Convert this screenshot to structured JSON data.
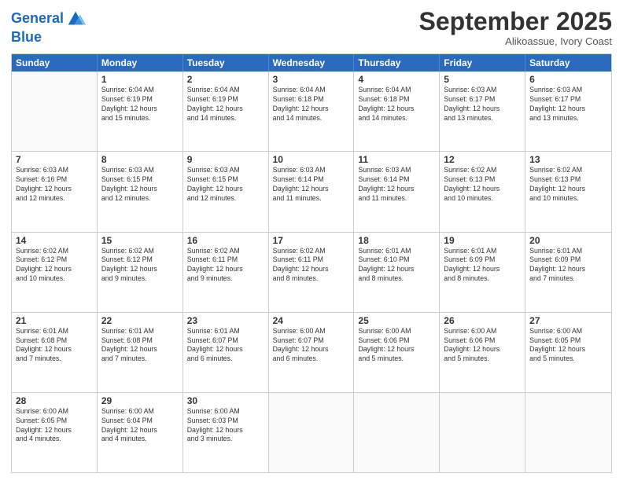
{
  "header": {
    "logo_line1": "General",
    "logo_line2": "Blue",
    "month": "September 2025",
    "location": "Alikoassue, Ivory Coast"
  },
  "weekdays": [
    "Sunday",
    "Monday",
    "Tuesday",
    "Wednesday",
    "Thursday",
    "Friday",
    "Saturday"
  ],
  "rows": [
    [
      {
        "day": "",
        "info": ""
      },
      {
        "day": "1",
        "info": "Sunrise: 6:04 AM\nSunset: 6:19 PM\nDaylight: 12 hours\nand 15 minutes."
      },
      {
        "day": "2",
        "info": "Sunrise: 6:04 AM\nSunset: 6:19 PM\nDaylight: 12 hours\nand 14 minutes."
      },
      {
        "day": "3",
        "info": "Sunrise: 6:04 AM\nSunset: 6:18 PM\nDaylight: 12 hours\nand 14 minutes."
      },
      {
        "day": "4",
        "info": "Sunrise: 6:04 AM\nSunset: 6:18 PM\nDaylight: 12 hours\nand 14 minutes."
      },
      {
        "day": "5",
        "info": "Sunrise: 6:03 AM\nSunset: 6:17 PM\nDaylight: 12 hours\nand 13 minutes."
      },
      {
        "day": "6",
        "info": "Sunrise: 6:03 AM\nSunset: 6:17 PM\nDaylight: 12 hours\nand 13 minutes."
      }
    ],
    [
      {
        "day": "7",
        "info": "Sunrise: 6:03 AM\nSunset: 6:16 PM\nDaylight: 12 hours\nand 12 minutes."
      },
      {
        "day": "8",
        "info": "Sunrise: 6:03 AM\nSunset: 6:15 PM\nDaylight: 12 hours\nand 12 minutes."
      },
      {
        "day": "9",
        "info": "Sunrise: 6:03 AM\nSunset: 6:15 PM\nDaylight: 12 hours\nand 12 minutes."
      },
      {
        "day": "10",
        "info": "Sunrise: 6:03 AM\nSunset: 6:14 PM\nDaylight: 12 hours\nand 11 minutes."
      },
      {
        "day": "11",
        "info": "Sunrise: 6:03 AM\nSunset: 6:14 PM\nDaylight: 12 hours\nand 11 minutes."
      },
      {
        "day": "12",
        "info": "Sunrise: 6:02 AM\nSunset: 6:13 PM\nDaylight: 12 hours\nand 10 minutes."
      },
      {
        "day": "13",
        "info": "Sunrise: 6:02 AM\nSunset: 6:13 PM\nDaylight: 12 hours\nand 10 minutes."
      }
    ],
    [
      {
        "day": "14",
        "info": "Sunrise: 6:02 AM\nSunset: 6:12 PM\nDaylight: 12 hours\nand 10 minutes."
      },
      {
        "day": "15",
        "info": "Sunrise: 6:02 AM\nSunset: 6:12 PM\nDaylight: 12 hours\nand 9 minutes."
      },
      {
        "day": "16",
        "info": "Sunrise: 6:02 AM\nSunset: 6:11 PM\nDaylight: 12 hours\nand 9 minutes."
      },
      {
        "day": "17",
        "info": "Sunrise: 6:02 AM\nSunset: 6:11 PM\nDaylight: 12 hours\nand 8 minutes."
      },
      {
        "day": "18",
        "info": "Sunrise: 6:01 AM\nSunset: 6:10 PM\nDaylight: 12 hours\nand 8 minutes."
      },
      {
        "day": "19",
        "info": "Sunrise: 6:01 AM\nSunset: 6:09 PM\nDaylight: 12 hours\nand 8 minutes."
      },
      {
        "day": "20",
        "info": "Sunrise: 6:01 AM\nSunset: 6:09 PM\nDaylight: 12 hours\nand 7 minutes."
      }
    ],
    [
      {
        "day": "21",
        "info": "Sunrise: 6:01 AM\nSunset: 6:08 PM\nDaylight: 12 hours\nand 7 minutes."
      },
      {
        "day": "22",
        "info": "Sunrise: 6:01 AM\nSunset: 6:08 PM\nDaylight: 12 hours\nand 7 minutes."
      },
      {
        "day": "23",
        "info": "Sunrise: 6:01 AM\nSunset: 6:07 PM\nDaylight: 12 hours\nand 6 minutes."
      },
      {
        "day": "24",
        "info": "Sunrise: 6:00 AM\nSunset: 6:07 PM\nDaylight: 12 hours\nand 6 minutes."
      },
      {
        "day": "25",
        "info": "Sunrise: 6:00 AM\nSunset: 6:06 PM\nDaylight: 12 hours\nand 5 minutes."
      },
      {
        "day": "26",
        "info": "Sunrise: 6:00 AM\nSunset: 6:06 PM\nDaylight: 12 hours\nand 5 minutes."
      },
      {
        "day": "27",
        "info": "Sunrise: 6:00 AM\nSunset: 6:05 PM\nDaylight: 12 hours\nand 5 minutes."
      }
    ],
    [
      {
        "day": "28",
        "info": "Sunrise: 6:00 AM\nSunset: 6:05 PM\nDaylight: 12 hours\nand 4 minutes."
      },
      {
        "day": "29",
        "info": "Sunrise: 6:00 AM\nSunset: 6:04 PM\nDaylight: 12 hours\nand 4 minutes."
      },
      {
        "day": "30",
        "info": "Sunrise: 6:00 AM\nSunset: 6:03 PM\nDaylight: 12 hours\nand 3 minutes."
      },
      {
        "day": "",
        "info": ""
      },
      {
        "day": "",
        "info": ""
      },
      {
        "day": "",
        "info": ""
      },
      {
        "day": "",
        "info": ""
      }
    ]
  ]
}
